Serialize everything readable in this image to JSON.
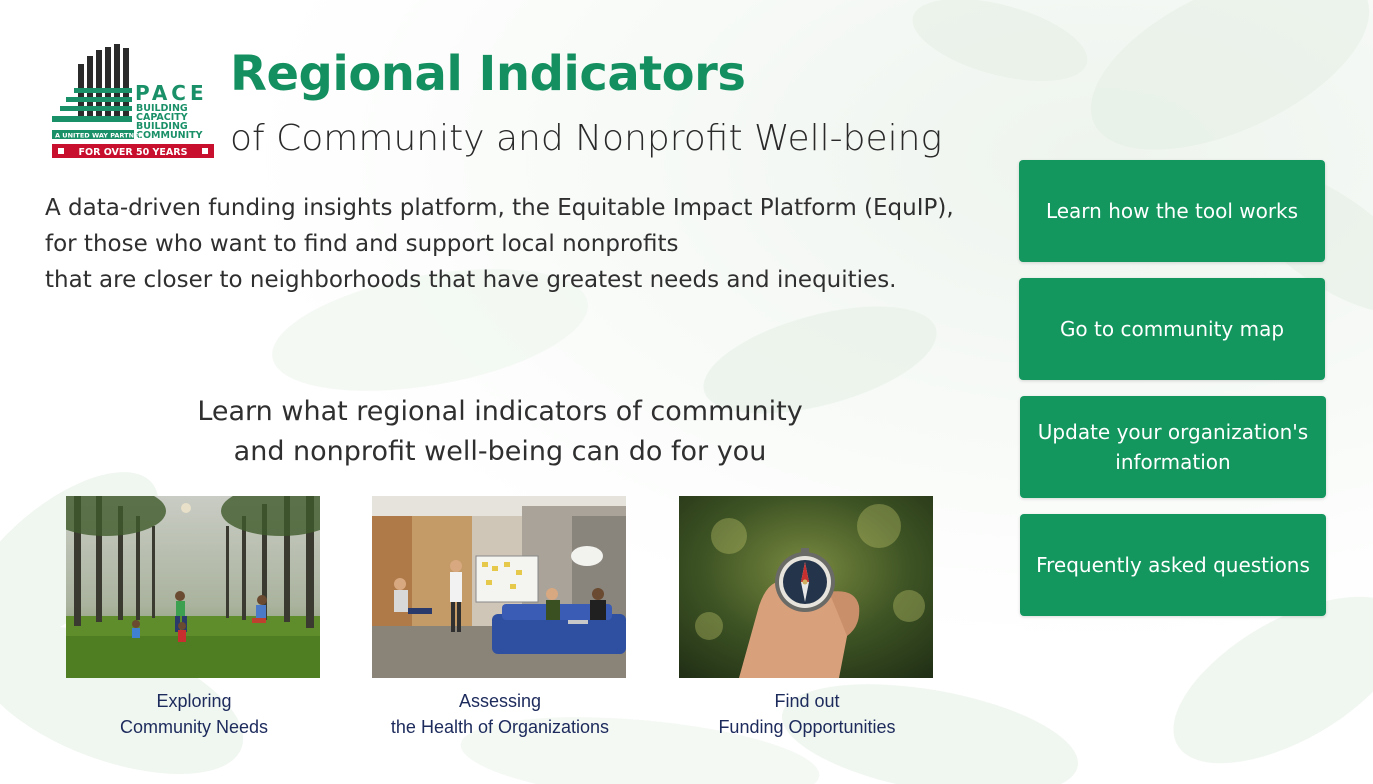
{
  "logo": {
    "word": "PACE",
    "lines": [
      "BUILDING",
      "CAPACITY",
      "BUILDING",
      "COMMUNITY"
    ],
    "partner": "A UNITED WAY PARTNER",
    "tagline": "FOR OVER 50 YEARS",
    "colors": {
      "green": "#1a9068",
      "dark": "#2b2b2b",
      "red": "#c8102e"
    }
  },
  "header": {
    "title": "Regional Indicators",
    "subtitle": "of Community and Nonprofit Well-being"
  },
  "description": {
    "line1": "A data-driven funding insights platform, the Equitable Impact Platform (EquIP),",
    "line2": "for those who want to find and support local nonprofits",
    "line3": "that are closer to neighborhoods that have greatest needs and inequities."
  },
  "learn": {
    "line1": "Learn what regional indicators of community",
    "line2": "and nonprofit well-being can do for you"
  },
  "cards": [
    {
      "line1": "Exploring",
      "line2": "Community Needs",
      "image": "children-playing-in-forest"
    },
    {
      "line1": "Assessing",
      "line2": "the Health of Organizations",
      "image": "team-meeting-in-office"
    },
    {
      "line1": "Find out",
      "line2": "Funding Opportunities",
      "image": "hand-holding-compass"
    }
  ],
  "nav": {
    "how_it_works": "Learn how the tool works",
    "community_map": "Go to community map",
    "update_org": "Update your organization's information",
    "faq": "Frequently asked questions"
  },
  "colors": {
    "accent": "#13975f",
    "title_green": "#149060",
    "caption_navy": "#1c2a5c"
  }
}
